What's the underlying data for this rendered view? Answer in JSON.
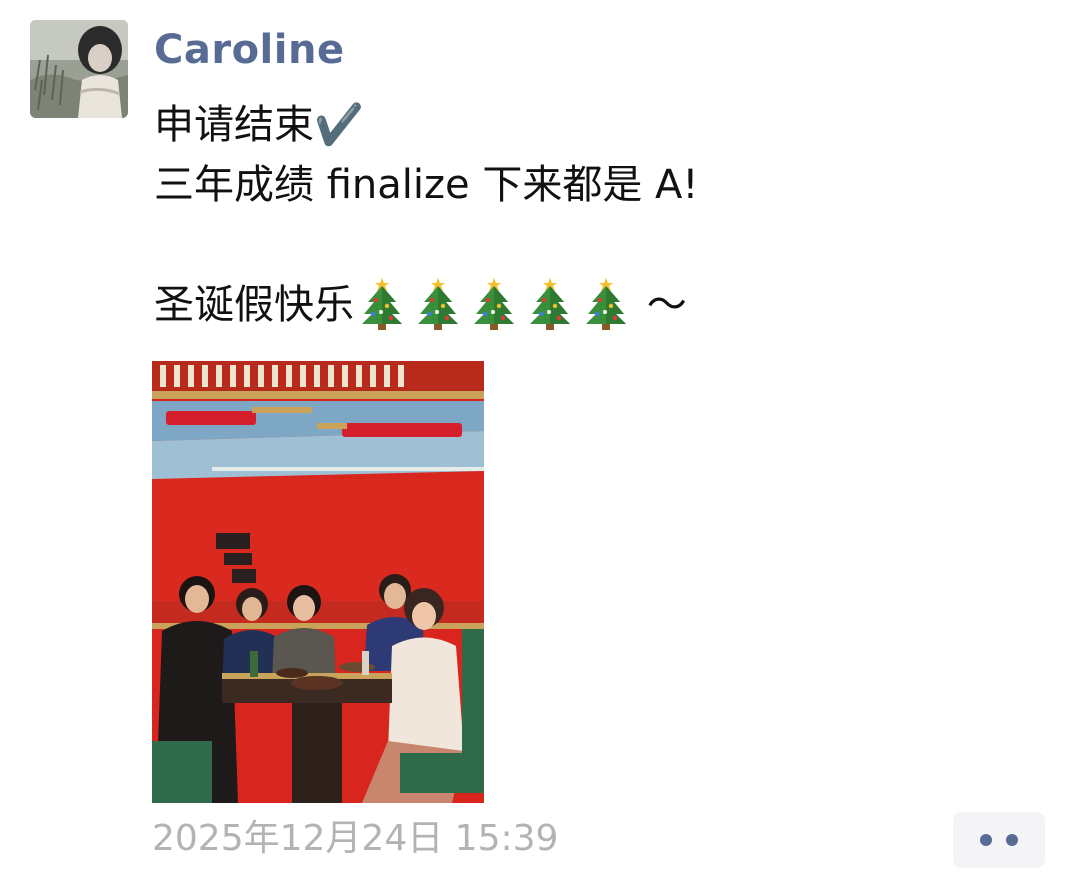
{
  "post": {
    "author": "Caroline",
    "lines": [
      "申请结束✔️",
      "三年成绩 finalize 下来都是 A!",
      "",
      "圣诞假快乐",
      "～"
    ],
    "emoji_count": 5,
    "emoji_icon": "christmas-tree-icon",
    "timestamp": "2025年12月24日 15:39"
  },
  "colors": {
    "author_name": "#576b95",
    "text": "#111111",
    "timestamp": "#b3b3b3",
    "more_button_bg": "#f4f4f6",
    "more_dots": "#576b95",
    "photo_wall": "#d8251d"
  },
  "icons": {
    "more": "more-dots-icon",
    "avatar": "avatar"
  }
}
